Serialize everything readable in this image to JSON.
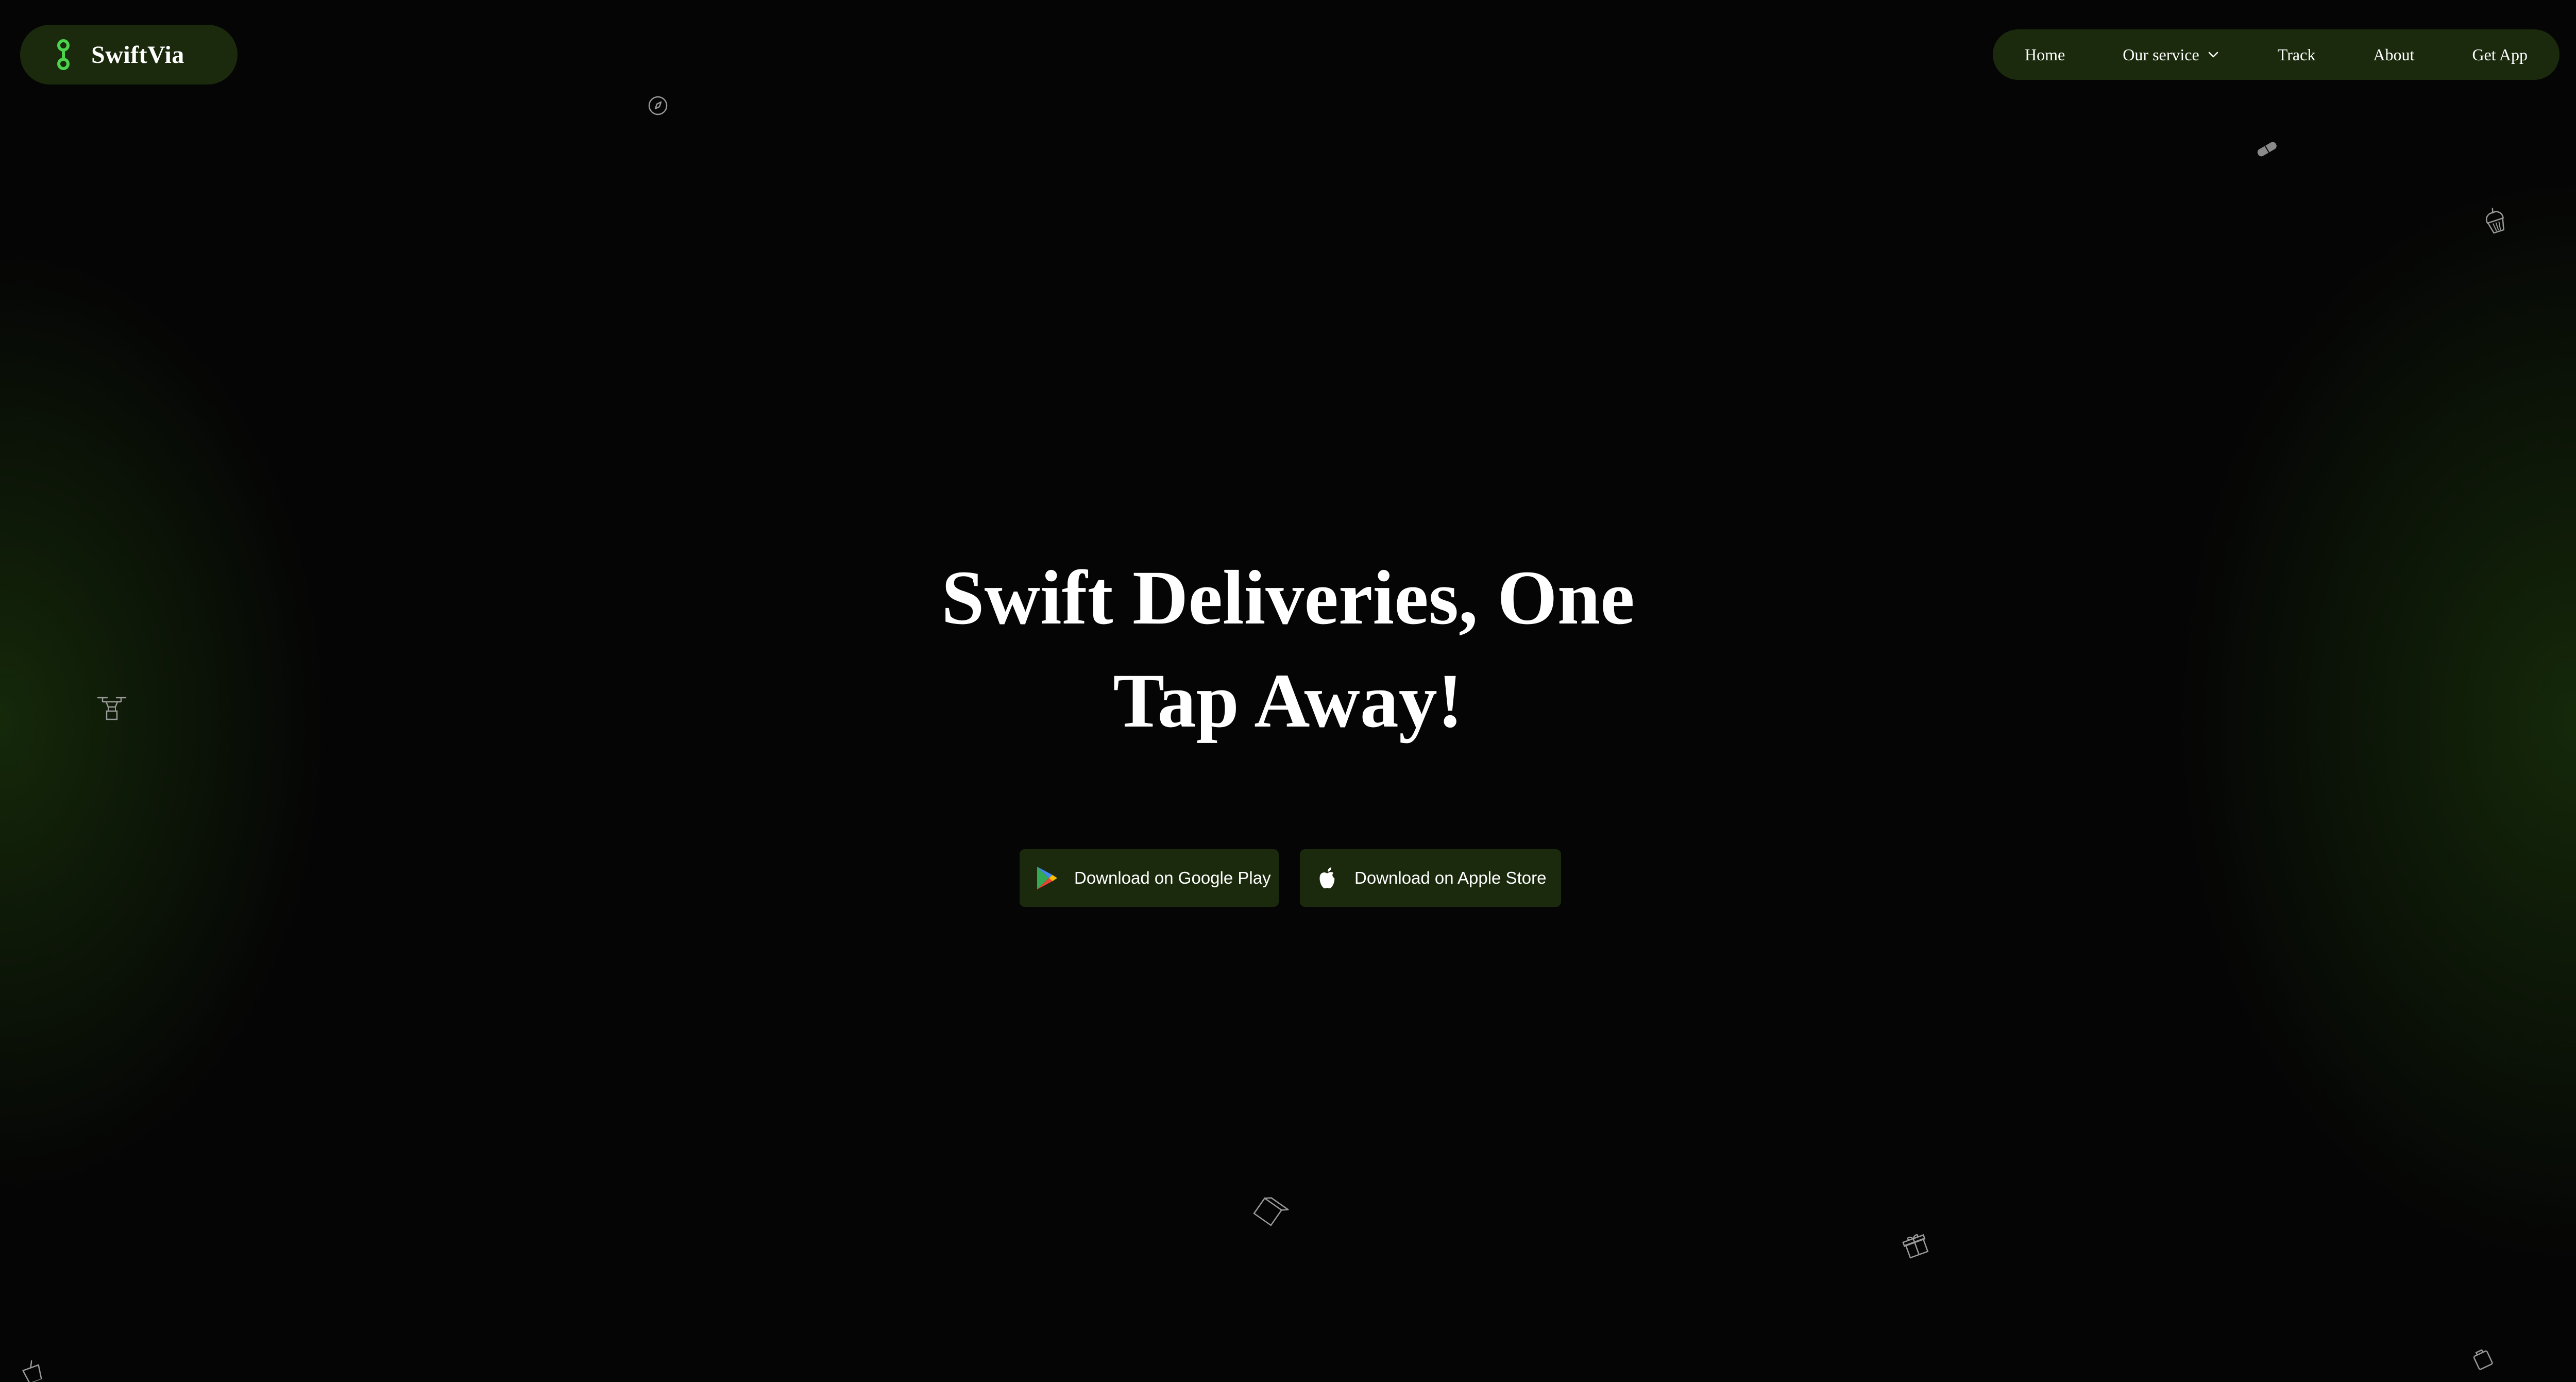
{
  "brand": {
    "name": "SwiftVia",
    "accent_color": "#4cd34c",
    "pill_color": "#1b2a0d"
  },
  "nav": {
    "items": [
      {
        "label": "Home",
        "icon": null
      },
      {
        "label": "Our service",
        "icon": "chevron-down-icon"
      },
      {
        "label": "Track",
        "icon": null
      },
      {
        "label": "About",
        "icon": null
      },
      {
        "label": "Get App",
        "icon": null
      }
    ]
  },
  "hero": {
    "title_line1": "Swift Deliveries, One",
    "title_line2": "Tap Away!"
  },
  "downloads": {
    "google_label": "Download on Google Play",
    "google_icon": "google-play-icon",
    "apple_label": "Download on Apple Store",
    "apple_icon": "apple-icon"
  },
  "decor_icons": [
    "compass-icon",
    "pill-icon",
    "cupcake-icon",
    "drone-icon",
    "package-icon",
    "gift-icon",
    "cup-icon",
    "bag-icon"
  ],
  "colors": {
    "background": "#050505",
    "glow": "#22460e"
  }
}
